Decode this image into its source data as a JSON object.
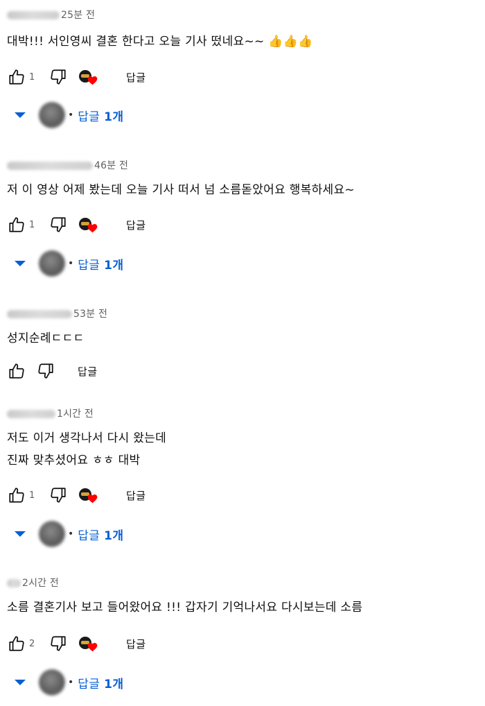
{
  "comments": [
    {
      "time": "25분 전",
      "lines": [
        "대박!!! 서인영씨 결혼 한다고 오늘 기사 떴네요~~ 👍👍👍"
      ],
      "likes": "1",
      "hearted": true,
      "reply_label": "답글",
      "replies_prefix": "답글 ",
      "replies_count": "1개"
    },
    {
      "time": "46분 전",
      "lines": [
        "저 이 영상 어제 봤는데 오늘 기사 떠서 넘 소름돋았어요 행복하세요~"
      ],
      "likes": "1",
      "hearted": true,
      "reply_label": "답글",
      "replies_prefix": "답글 ",
      "replies_count": "1개"
    },
    {
      "time": "53분 전",
      "lines": [
        "성지순례ㄷㄷㄷ"
      ],
      "likes": "",
      "hearted": false,
      "reply_label": "답글"
    },
    {
      "time": "1시간 전",
      "lines": [
        "저도 이거 생각나서 다시 왔는데",
        "진짜 맞추셨어요 ㅎㅎ 대박"
      ],
      "likes": "1",
      "hearted": true,
      "reply_label": "답글",
      "replies_prefix": "답글 ",
      "replies_count": "1개"
    },
    {
      "time": "2시간 전",
      "lines": [
        "소름 결혼기사 보고 들어왔어요 !!! 갑자기 기억나서요  다시보는데 소름"
      ],
      "likes": "2",
      "hearted": true,
      "reply_label": "답글",
      "replies_prefix": "답글 ",
      "replies_count": "1개"
    }
  ],
  "icons": {
    "like": "thumb-up-icon",
    "dislike": "thumb-down-icon",
    "heart": "creator-heart-icon",
    "expand": "caret-down-icon"
  },
  "colors": {
    "link": "#065fd4",
    "heart": "#ff0000",
    "meta": "#606060"
  }
}
